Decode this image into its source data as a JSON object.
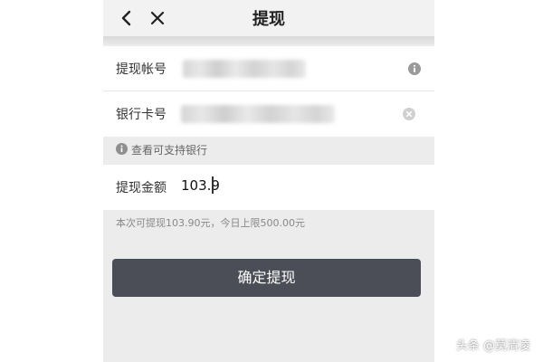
{
  "header": {
    "back_icon": "chevron-left-icon",
    "close_icon": "close-icon",
    "title": "提现"
  },
  "form": {
    "account": {
      "label": "提现帐号",
      "info_icon": "info-icon"
    },
    "bank_card": {
      "label": "银行卡号",
      "clear_icon": "clear-circle-icon"
    },
    "supported_banks_link": "查看可支持银行",
    "amount": {
      "label": "提现金额",
      "value": "103.9"
    },
    "limit_note": "本次可提现103.90元，今日上限500.00元"
  },
  "confirm_button": {
    "label": "确定提现"
  },
  "watermark": "头条 @莫清凌",
  "colors": {
    "primary_button": "#4b4d57",
    "page_background": "#ececec",
    "icon_gray": "#9a9a9a"
  }
}
